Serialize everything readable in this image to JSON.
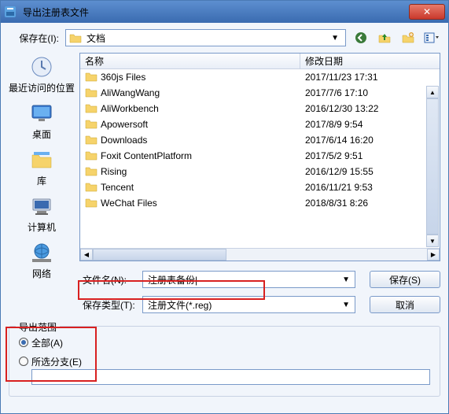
{
  "title": "导出注册表文件",
  "close_label": "✕",
  "top": {
    "saveInLabel": "保存在(I):",
    "location": "文档"
  },
  "toolbar": {
    "backIcon": "back-icon",
    "upIcon": "up-icon",
    "newIcon": "new-folder-icon",
    "viewIcon": "view-icon"
  },
  "sidebar": {
    "items": [
      {
        "label": "最近访问的位置",
        "icon": "recent"
      },
      {
        "label": "桌面",
        "icon": "desktop"
      },
      {
        "label": "库",
        "icon": "library"
      },
      {
        "label": "计算机",
        "icon": "computer"
      },
      {
        "label": "网络",
        "icon": "network"
      }
    ]
  },
  "fileList": {
    "headers": {
      "name": "名称",
      "date": "修改日期"
    },
    "rows": [
      {
        "name": "360js Files",
        "date": "2017/11/23 17:31"
      },
      {
        "name": "AliWangWang",
        "date": "2017/7/6 17:10"
      },
      {
        "name": "AliWorkbench",
        "date": "2016/12/30 13:22"
      },
      {
        "name": "Apowersoft",
        "date": "2017/8/9 9:54"
      },
      {
        "name": "Downloads",
        "date": "2017/6/14 16:20"
      },
      {
        "name": "Foxit ContentPlatform",
        "date": "2017/5/2 9:51"
      },
      {
        "name": "Rising",
        "date": "2016/12/9 15:55"
      },
      {
        "name": "Tencent",
        "date": "2016/11/21 9:53"
      },
      {
        "name": "WeChat Files",
        "date": "2018/8/31 8:26"
      }
    ]
  },
  "fields": {
    "fileNameLabel": "文件名(N):",
    "fileNameValue": "注册表备份|",
    "fileTypeLabel": "保存类型(T):",
    "fileTypeValue": "注册文件(*.reg)",
    "saveBtn": "保存(S)",
    "cancelBtn": "取消"
  },
  "exportRange": {
    "legend": "导出范围",
    "allLabel": "全部(A)",
    "branchLabel": "所选分支(E)",
    "branchValue": "",
    "selected": "all"
  }
}
